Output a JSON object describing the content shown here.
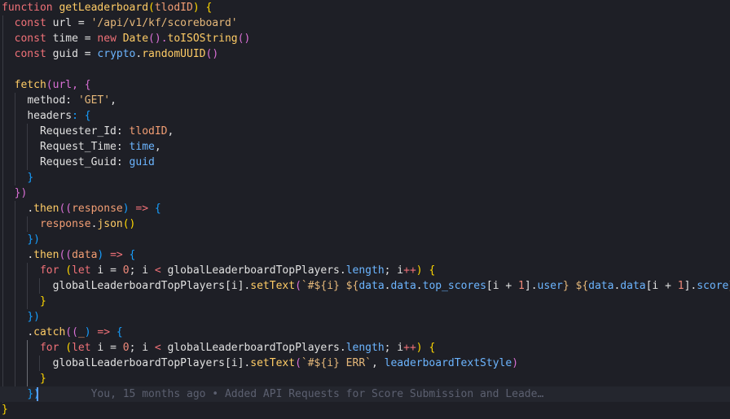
{
  "code": {
    "l1": [
      "function",
      " ",
      "getLeaderboard",
      "(",
      "tlodID",
      ")",
      " {"
    ],
    "l2": [
      "const",
      " url = ",
      "'/api/v1/kf/scoreboard'"
    ],
    "l3": [
      "const",
      " time = ",
      "new",
      " ",
      "Date",
      "().",
      "toISOString",
      "()"
    ],
    "l4": [
      "const",
      " guid = ",
      "crypto",
      ".",
      "randomUUID",
      "()"
    ],
    "l6": [
      "fetch",
      "(url, {"
    ],
    "l7": [
      "method",
      ": ",
      "'GET'",
      ","
    ],
    "l8": [
      "headers",
      ": {"
    ],
    "l9": [
      "Requester_Id",
      ": ",
      "tlodID",
      ","
    ],
    "l10": [
      "Request_Time",
      ": ",
      "time",
      ","
    ],
    "l11": [
      "Request_Guid",
      ": ",
      "guid"
    ],
    "l12": [
      "}"
    ],
    "l13": [
      "})"
    ],
    "l14": [
      ".",
      "then",
      "((",
      "response",
      ") ",
      "=>",
      " {"
    ],
    "l15": [
      "response",
      ".",
      "json",
      "()"
    ],
    "l16": [
      "})"
    ],
    "l17": [
      ".",
      "then",
      "((",
      "data",
      ") ",
      "=>",
      " {"
    ],
    "l18": [
      "for",
      " (",
      "let",
      " i = ",
      "0",
      "; i ",
      "<",
      " globalLeaderboardTopPlayers.",
      "length",
      "; i",
      "++",
      ") {"
    ],
    "l19": [
      "globalLeaderboardTopPlayers[i].",
      "setText",
      "(",
      "`#${i} ${",
      "data",
      ".",
      "data",
      ".",
      "top_scores",
      "[i + ",
      "1",
      "].",
      "user",
      "} ${",
      "data",
      ".",
      "data",
      "[i + ",
      "1",
      "].",
      "score",
      "}`"
    ],
    "l20": [
      "}"
    ],
    "l21": [
      "})"
    ],
    "l22": [
      ".",
      "catch",
      "((",
      "_",
      ") ",
      "=>",
      " {"
    ],
    "l23": [
      "for",
      " (",
      "let",
      " i = ",
      "0",
      "; i ",
      "<",
      " globalLeaderboardTopPlayers.",
      "length",
      "; i",
      "++",
      ") {"
    ],
    "l24": [
      "globalLeaderboardTopPlayers[i].",
      "setText",
      "(",
      "`#${i} ERR`",
      ", ",
      "leaderboardTextStyle",
      ")"
    ],
    "l25": [
      "}"
    ],
    "l26": [
      "})"
    ],
    "l27": [
      "}"
    ]
  },
  "blame": "You, 15 months ago • Added API Requests for Score Submission and Leade…",
  "colors": {
    "background": "#1e1f26",
    "keyword": "#f07178",
    "function": "#ffcc66",
    "string": "#e6b87a",
    "identifier": "#6cb5ff",
    "cursor": "#5aa0ff"
  }
}
